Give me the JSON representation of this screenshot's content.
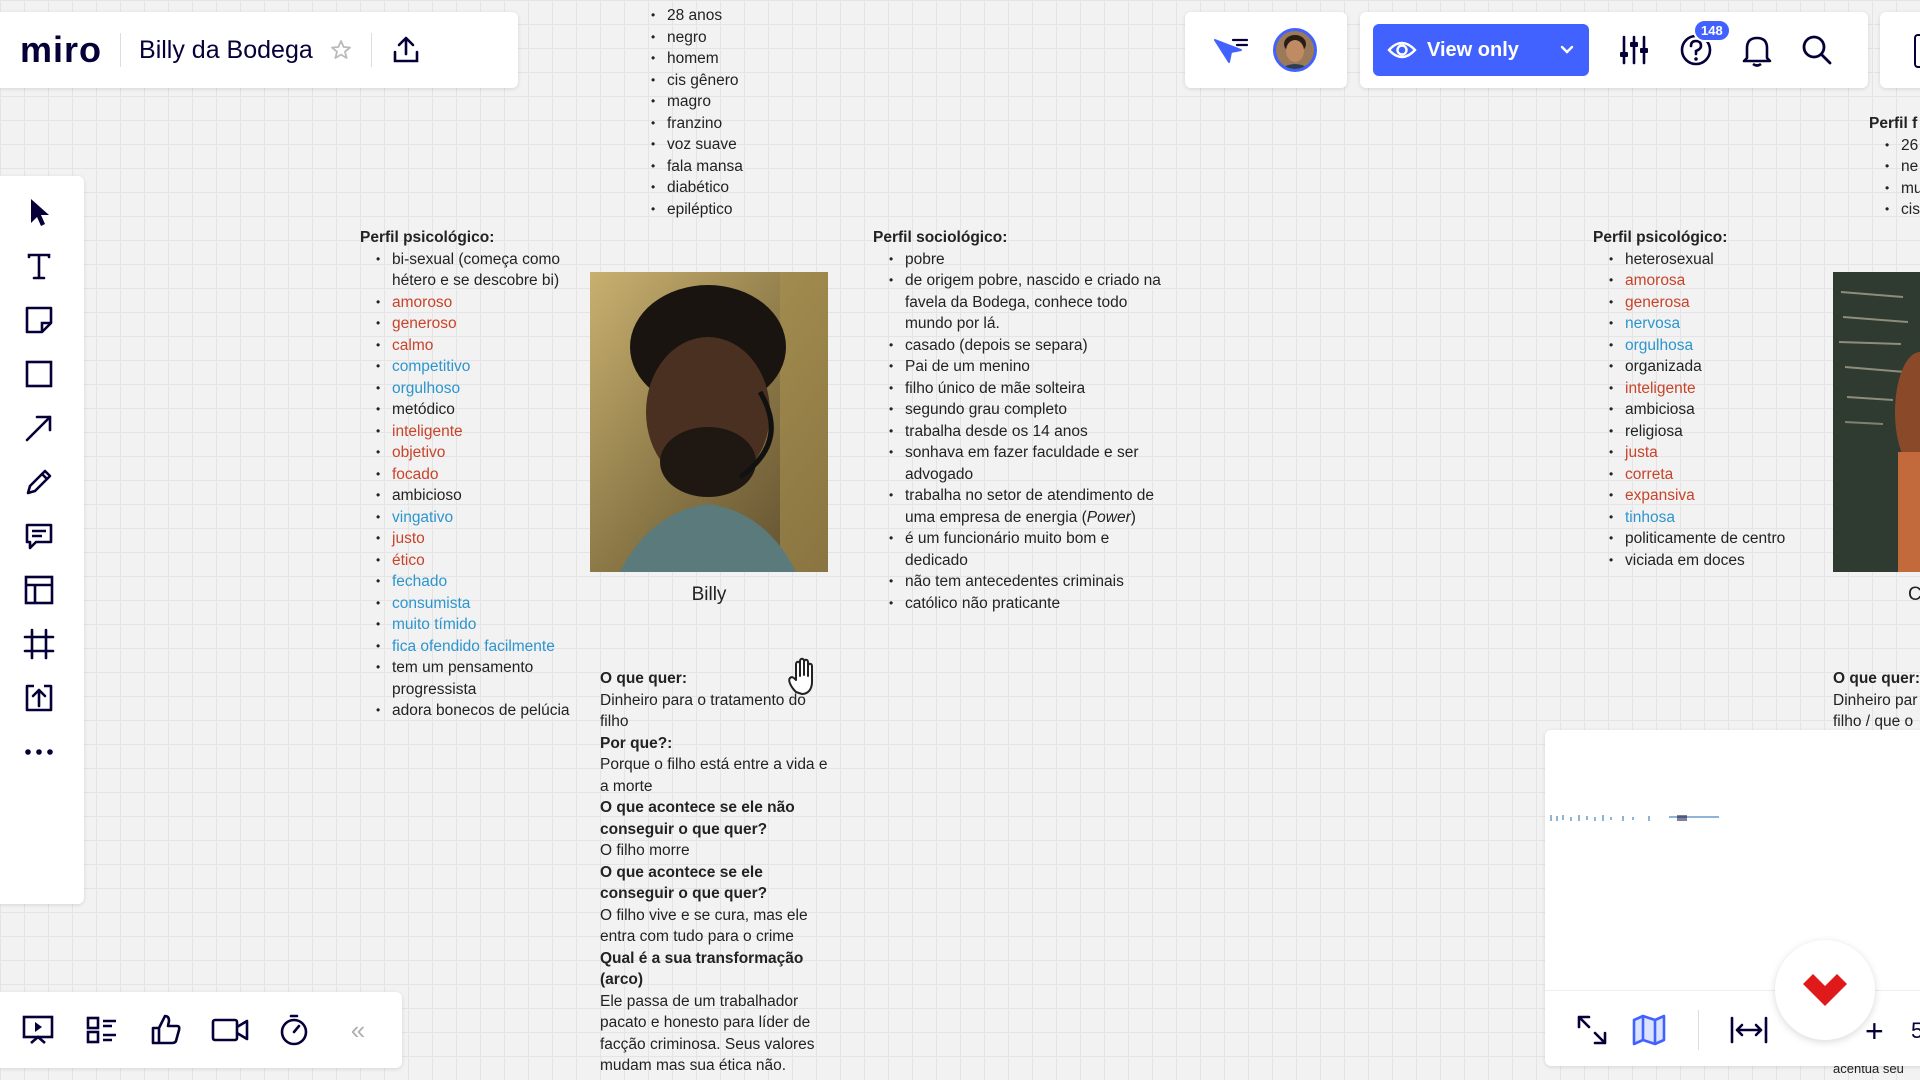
{
  "app": {
    "logo": "miro",
    "board_title": "Billy da Bodega"
  },
  "header": {
    "view_only_label": "View only",
    "help_badge": "148",
    "colors": {
      "accent": "#4262ff",
      "badge": "#4262ff"
    }
  },
  "left_toolbar": {
    "icons": [
      "select-cursor-icon",
      "text-icon",
      "sticky-note-icon",
      "shape-icon",
      "arrow-icon",
      "pen-icon",
      "comment-icon",
      "templates-icon",
      "frame-icon",
      "upload-icon",
      "more-icon"
    ]
  },
  "bottom_toolbar": {
    "icons": [
      "presentation-icon",
      "card-list-icon",
      "like-icon",
      "video-icon",
      "timer-icon",
      "collapse-icon"
    ],
    "collapse_label": "«"
  },
  "canvas": {
    "top_list": [
      "28 anos",
      "negro",
      "homem",
      "cis gênero",
      "magro",
      "franzino",
      "voz suave",
      "fala mansa",
      "diabético",
      "epiléptico"
    ],
    "billy_psych": {
      "heading": "Perfil psicológico:",
      "items": [
        {
          "text": "bi-sexual (começa como hétero e se descobre bi)",
          "color": "black"
        },
        {
          "text": "amoroso",
          "color": "red"
        },
        {
          "text": "generoso",
          "color": "red"
        },
        {
          "text": "calmo",
          "color": "red"
        },
        {
          "text": "competitivo",
          "color": "blue"
        },
        {
          "text": "orgulhoso",
          "color": "blue"
        },
        {
          "text": "metódico",
          "color": "black"
        },
        {
          "text": "inteligente",
          "color": "red"
        },
        {
          "text": "objetivo",
          "color": "red"
        },
        {
          "text": "focado",
          "color": "red"
        },
        {
          "text": "ambicioso",
          "color": "black"
        },
        {
          "text": "vingativo",
          "color": "blue"
        },
        {
          "text": "justo",
          "color": "red"
        },
        {
          "text": "ético",
          "color": "red"
        },
        {
          "text": "fechado",
          "color": "blue"
        },
        {
          "text": "consumista",
          "color": "blue"
        },
        {
          "text": "muito tímido",
          "color": "blue"
        },
        {
          "text": "fica ofendido facilmente",
          "color": "blue"
        },
        {
          "text": "tem um pensamento progressista",
          "color": "black"
        },
        {
          "text": "adora bonecos de pelúcia",
          "color": "black"
        }
      ]
    },
    "billy_caption": "Billy",
    "billy_socio": {
      "heading": "Perfil sociológico:",
      "items": [
        "pobre",
        "de origem pobre, nascido e criado na favela da Bodega, conhece todo mundo por lá.",
        "casado (depois se separa)",
        "Pai de um menino",
        "filho único de mãe solteira",
        "segundo grau completo",
        "trabalha desde os 14 anos",
        "sonhava em fazer faculdade e ser advogado",
        "é um funcionário muito bom e dedicado",
        "não tem antecedentes criminais",
        "católico não praticante"
      ],
      "energy_prefix": "trabalha no setor de atendimento de uma empresa de energia (",
      "energy_italic": "Power",
      "energy_suffix": ")"
    },
    "billy_goals": {
      "q1": "O que quer:",
      "a1": "Dinheiro para o tratamento do filho",
      "q2": "Por que?:",
      "a2": "Porque o filho está entre a vida e a morte",
      "q3": "O que acontece se ele não conseguir o que quer?",
      "a3": "O filho morre",
      "q4": "O que acontece se ele conseguir o que quer?",
      "a4": "O filho vive e se cura, mas ele entra com tudo para o crime",
      "q5": "Qual é a sua transformação (arco)",
      "a5": "Ele passa de um trabalhador pacato e honesto para líder de facção criminosa. Seus valores mudam mas sua ética não."
    },
    "second_psych": {
      "heading": "Perfil psicológico:",
      "items": [
        {
          "text": "heterosexual",
          "color": "black"
        },
        {
          "text": "amorosa",
          "color": "red"
        },
        {
          "text": "generosa",
          "color": "red"
        },
        {
          "text": "nervosa",
          "color": "blue"
        },
        {
          "text": "orgulhosa",
          "color": "blue"
        },
        {
          "text": "organizada",
          "color": "black"
        },
        {
          "text": "inteligente",
          "color": "red"
        },
        {
          "text": "ambiciosa",
          "color": "black"
        },
        {
          "text": "religiosa",
          "color": "black"
        },
        {
          "text": "justa",
          "color": "red"
        },
        {
          "text": "correta",
          "color": "red"
        },
        {
          "text": "expansiva",
          "color": "red"
        },
        {
          "text": "tinhosa",
          "color": "blue"
        },
        {
          "text": "politicamente de centro",
          "color": "black"
        },
        {
          "text": "viciada em doces",
          "color": "black"
        }
      ]
    },
    "edge_fragments": {
      "top_heading": "Perfil f",
      "top_list": [
        "26",
        "ne",
        "mu",
        "cis"
      ],
      "caption_letter": "C",
      "q_label": "O que quer:",
      "a_line1": "Dinheiro par",
      "a_line2": "filho / que o",
      "bottom_fragment": "acentua seu"
    }
  },
  "minimap": {
    "zoom_plus": "+",
    "zoom_value": "5"
  },
  "colors": {
    "red": "#c8432a",
    "blue": "#2d95cd",
    "canvas": "#f2f2f2"
  }
}
